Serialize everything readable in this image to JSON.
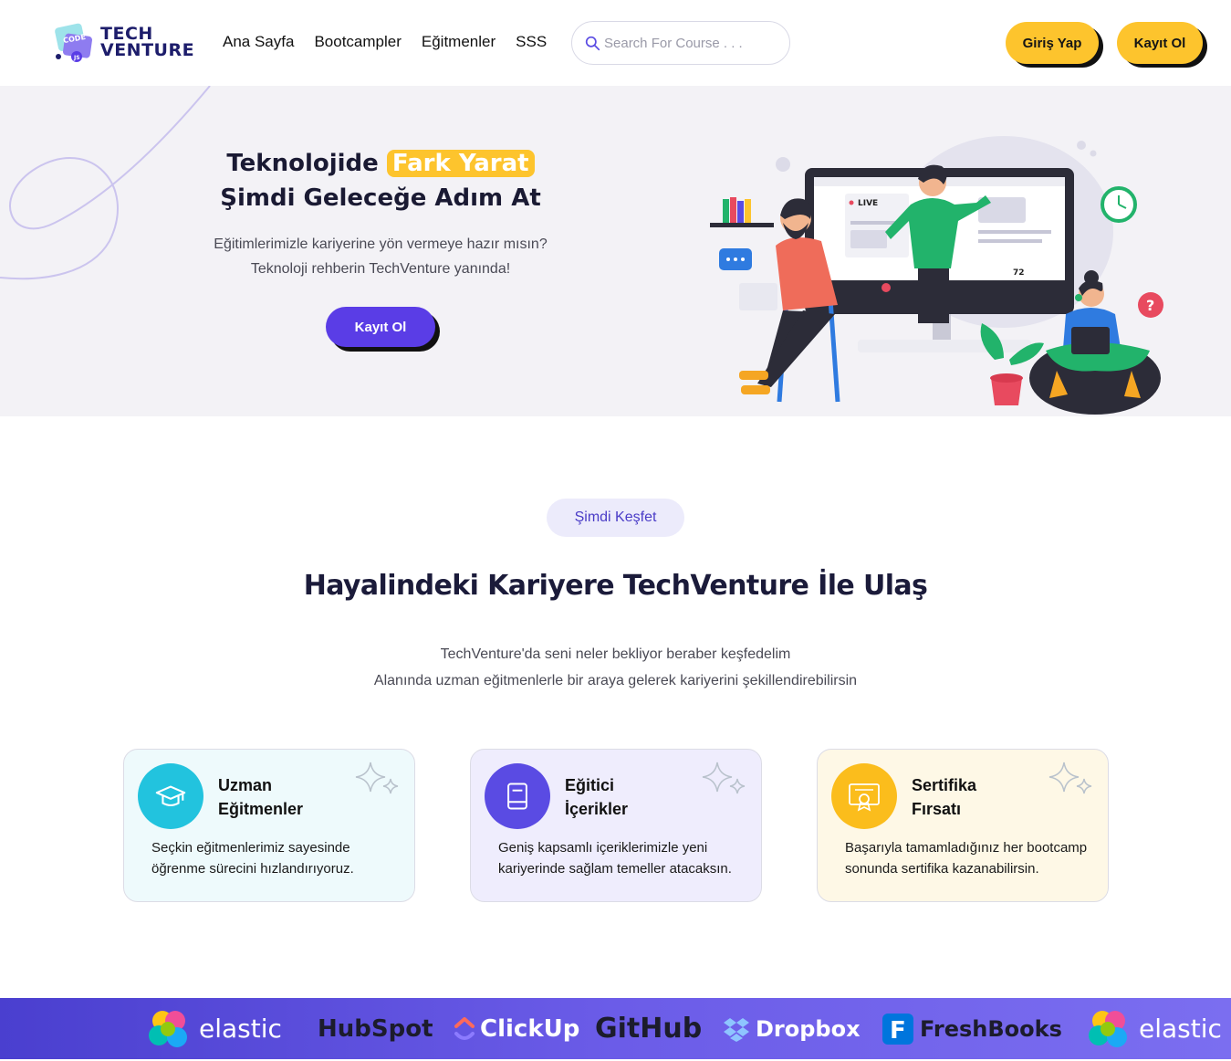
{
  "header": {
    "logo_line1": "TECH",
    "logo_line2": "VENTURE",
    "logo_badge_text": "CODE",
    "nav": [
      "Ana Sayfa",
      "Bootcampler",
      "Eğitmenler",
      "SSS"
    ],
    "search_placeholder": "Search For Course . . .",
    "login_label": "Giriş Yap",
    "signup_label": "Kayıt Ol"
  },
  "hero": {
    "title_part1": "Teknolojide",
    "title_highlight": "Fark Yarat",
    "title_line2": "Şimdi Geleceğe Adım At",
    "subtitle_line1": "Eğitimlerimizle kariyerine yön vermeye hazır mısın?",
    "subtitle_line2": "Teknoloji rehberin TechVenture yanında!",
    "cta_label": "Kayıt Ol",
    "illustration": {
      "live_label": "LIVE",
      "viewer_count": "72"
    }
  },
  "discover": {
    "pill_label": "Şimdi Keşfet",
    "title": "Hayalindeki Kariyere TechVenture İle Ulaş",
    "subtitle_line1": "TechVenture'da seni neler bekliyor beraber keşfedelim",
    "subtitle_line2": "Alanında uzman eğitmenlerle bir araya gelerek kariyerini şekillendirebilirsin"
  },
  "cards": [
    {
      "title_line1": "Uzman",
      "title_line2": "Eğitmenler",
      "text": "Seçkin eğitmenlerimiz sayesinde öğrenme sürecini hızlandırıyoruz.",
      "icon": "graduation-cap-icon",
      "icon_color": "#22c3de"
    },
    {
      "title_line1": "Eğitici",
      "title_line2": "İçerikler",
      "text": "Geniş kapsamlı içeriklerimizle yeni kariyerinde sağlam temeller atacaksın.",
      "icon": "book-icon",
      "icon_color": "#5a4be3"
    },
    {
      "title_line1": "Sertifika",
      "title_line2": "Fırsatı",
      "text": "Başarıyla tamamladığınız her bootcamp sonunda sertifika kazanabilirsin.",
      "icon": "certificate-icon",
      "icon_color": "#fbbd1c"
    }
  ],
  "brands": [
    "elastic",
    "HubSpot",
    "ClickUp",
    "GitHub",
    "Dropbox",
    "FreshBooks",
    "elastic"
  ],
  "colors": {
    "accent_yellow": "#fdc42d",
    "accent_purple": "#5a3de6",
    "title_dark": "#1b1b3a"
  }
}
